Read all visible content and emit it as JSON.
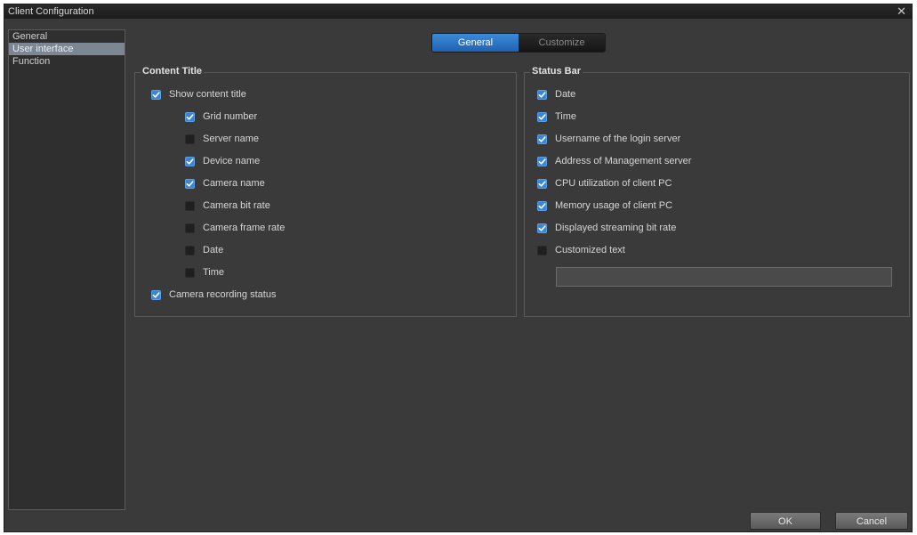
{
  "window": {
    "title": "Client Configuration",
    "close_glyph": "✕"
  },
  "sidebar": {
    "items": [
      {
        "label": "General",
        "selected": false
      },
      {
        "label": "User interface",
        "selected": true
      },
      {
        "label": "Function",
        "selected": false
      }
    ]
  },
  "tabs": [
    {
      "label": "General",
      "active": true
    },
    {
      "label": "Customize",
      "active": false
    }
  ],
  "content_title": {
    "heading": "Content Title",
    "show": {
      "label": "Show content title",
      "checked": true
    },
    "children": [
      {
        "label": "Grid number",
        "checked": true
      },
      {
        "label": "Server name",
        "checked": false
      },
      {
        "label": "Device name",
        "checked": true
      },
      {
        "label": "Camera name",
        "checked": true
      },
      {
        "label": "Camera bit rate",
        "checked": false
      },
      {
        "label": "Camera frame rate",
        "checked": false
      },
      {
        "label": "Date",
        "checked": false
      },
      {
        "label": "Time",
        "checked": false
      }
    ],
    "recording": {
      "label": "Camera recording status",
      "checked": true
    }
  },
  "status_bar": {
    "heading": "Status Bar",
    "items": [
      {
        "label": "Date",
        "checked": true
      },
      {
        "label": "Time",
        "checked": true
      },
      {
        "label": "Username of the login server",
        "checked": true
      },
      {
        "label": "Address of Management server",
        "checked": true
      },
      {
        "label": "CPU utilization of client PC",
        "checked": true
      },
      {
        "label": "Memory usage of client PC",
        "checked": true
      },
      {
        "label": "Displayed streaming bit rate",
        "checked": true
      },
      {
        "label": "Customized text",
        "checked": false
      }
    ],
    "custom_text_value": ""
  },
  "buttons": {
    "ok": "OK",
    "cancel": "Cancel"
  },
  "colors": {
    "accent": "#3a86d4",
    "background": "#3a3a3a"
  }
}
